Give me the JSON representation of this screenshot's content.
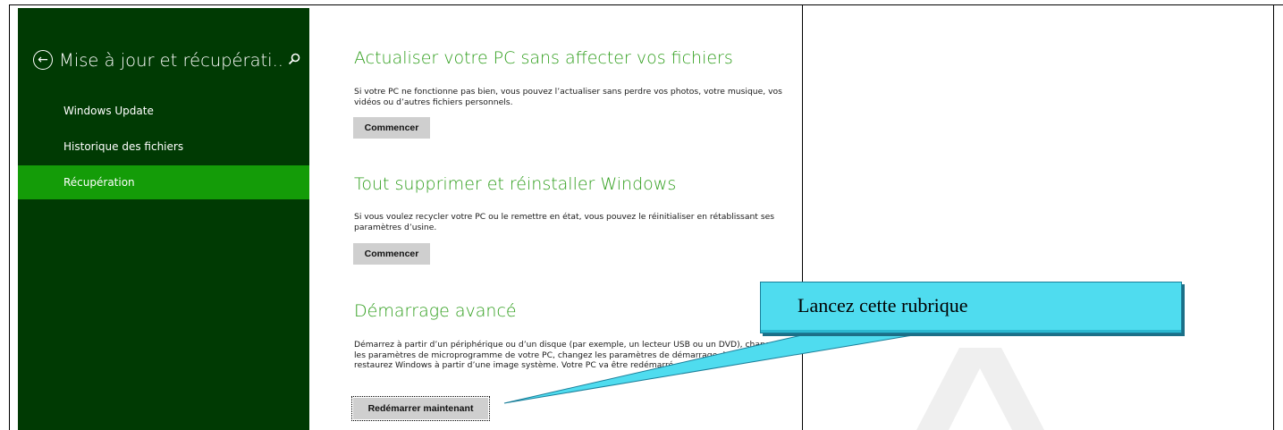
{
  "sidebar": {
    "title": "Mise à jour et récupérati..",
    "back_icon": "back-arrow-circle-icon",
    "search_icon": "search-icon",
    "items": [
      {
        "label": "Windows Update",
        "active": false
      },
      {
        "label": "Historique des fichiers",
        "active": false
      },
      {
        "label": "Récupération",
        "active": true
      }
    ]
  },
  "sections": [
    {
      "title": "Actualiser votre PC sans affecter vos fichiers",
      "text": "Si votre PC ne fonctionne pas bien, vous pouvez l’actualiser sans perdre vos photos, votre musique, vos vidéos ou d’autres fichiers personnels.",
      "button": "Commencer"
    },
    {
      "title": "Tout supprimer et réinstaller Windows",
      "text": "Si vous voulez recycler votre PC ou le remettre en état, vous pouvez le réinitialiser en rétablissant ses paramètres d’usine.",
      "button": "Commencer"
    },
    {
      "title": "Démarrage avancé",
      "text": "Démarrez à partir d’un périphérique ou d’un disque (par exemple, un lecteur USB ou un DVD), changez les paramètres de microprogramme de votre PC, changez les paramètres de démarrage de Windows ou restaurez Windows à partir d’une image système. Votre PC va être redémarré.",
      "button": "Redémarrer maintenant"
    }
  ],
  "callout": {
    "text": "Lancez cette rubrique"
  },
  "colors": {
    "sidebar_bg": "#003a03",
    "active_item": "#149c08",
    "section_title": "#2f9e1c",
    "callout_bg": "#4fdcef"
  }
}
